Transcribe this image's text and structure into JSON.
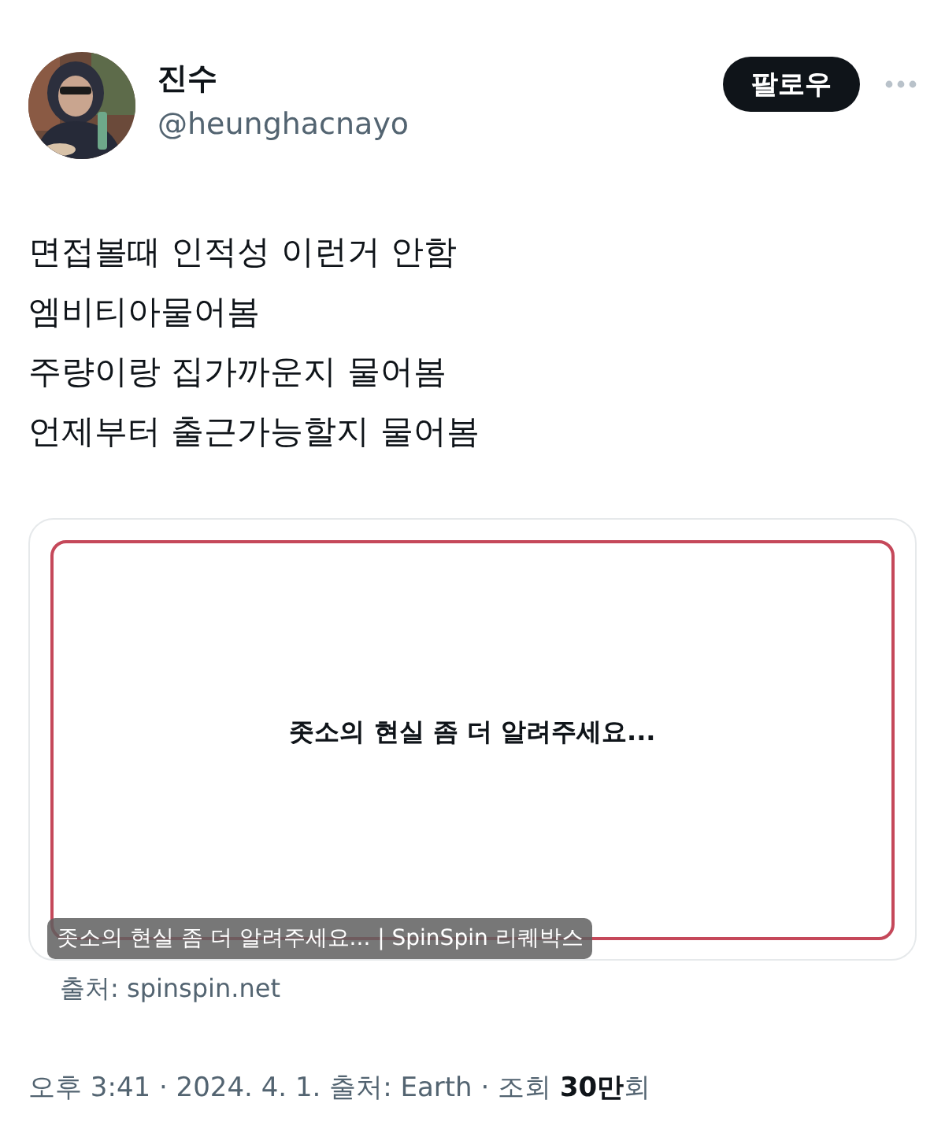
{
  "author": {
    "name": "진수",
    "handle": "@heunghacnayo",
    "follow_button": "팔로우"
  },
  "body_lines": [
    "면접볼때 인적성 이런거 안함",
    "엠비티아물어봄",
    "주량이랑 집가까운지 물어봄",
    "언제부터 출근가능할지 물어봄"
  ],
  "link_card": {
    "image_text": "좃소의 현실 좀 더 알려주세요...",
    "caption": "좃소의 현실 좀 더 알려주세요... | SpinSpin 리퀘박스",
    "source": "출처: spinspin.net"
  },
  "meta": "오후 3:41 · 2024. 4. 1. 출처: Earth · 조회 **30만**회"
}
